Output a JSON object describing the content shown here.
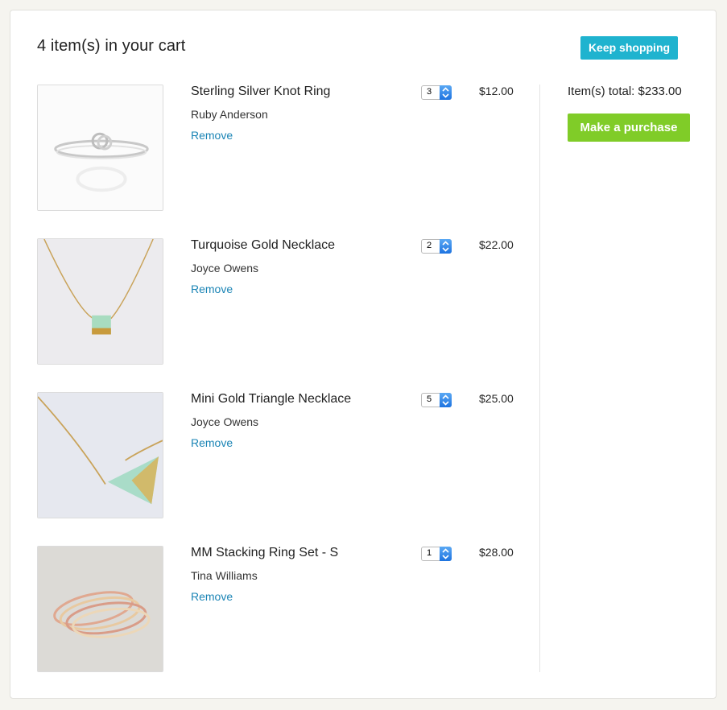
{
  "cart": {
    "title": "4 item(s) in your cart",
    "keep_shopping_label": "Keep shopping",
    "total_text": "Item(s) total: $233.00",
    "purchase_label": "Make a purchase",
    "remove_label": "Remove",
    "items": [
      {
        "name": "Sterling Silver Knot Ring",
        "seller": "Ruby Anderson",
        "qty": "3",
        "price": "$12.00"
      },
      {
        "name": "Turquoise Gold Necklace",
        "seller": "Joyce Owens",
        "qty": "2",
        "price": "$22.00"
      },
      {
        "name": "Mini Gold Triangle Necklace",
        "seller": "Joyce Owens",
        "qty": "5",
        "price": "$25.00"
      },
      {
        "name": "MM Stacking Ring Set - S",
        "seller": "Tina Williams",
        "qty": "1",
        "price": "$28.00"
      }
    ]
  },
  "colors": {
    "keep_shopping_bg": "#1fb3cf",
    "purchase_bg": "#80cc28",
    "link": "#1a84b5"
  },
  "icons": {
    "qty_arrow": "select-arrows-icon"
  }
}
